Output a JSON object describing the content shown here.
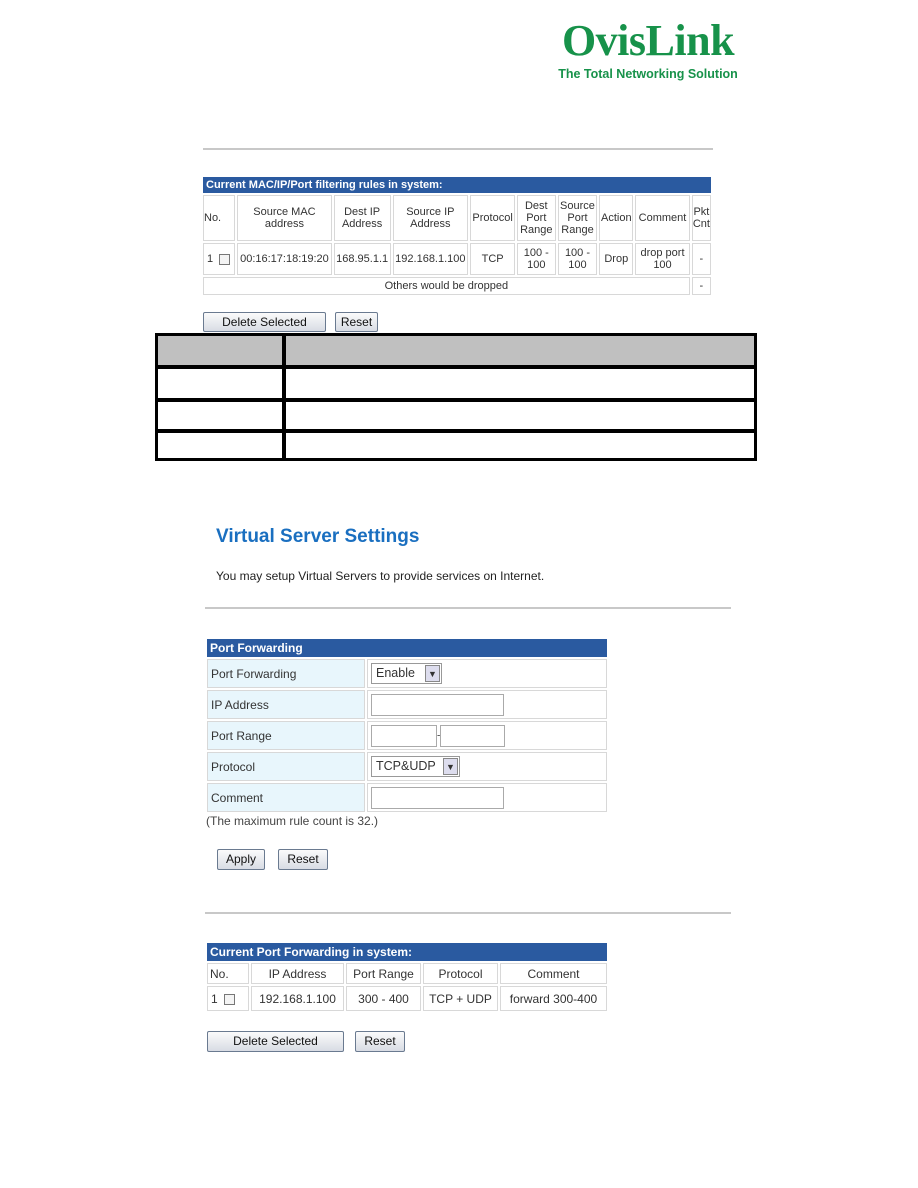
{
  "logo": {
    "name": "OvisLink",
    "tagline": "The Total Networking Solution",
    "color": "#17924a"
  },
  "filter_table": {
    "title": "Current MAC/IP/Port filtering rules in system:",
    "headers": [
      "No.",
      "Source MAC address",
      "Dest IP Address",
      "Source IP Address",
      "Protocol",
      "Dest Port Range",
      "Source Port Range",
      "Action",
      "Comment",
      "Pkt Cnt"
    ],
    "rows": [
      [
        "1",
        "00:16:17:18:19:20",
        "168.95.1.1",
        "192.168.1.100",
        "TCP",
        "100 - 100",
        "100 - 100",
        "Drop",
        "drop port 100",
        "-"
      ]
    ],
    "footer": "Others would be dropped",
    "footer_cnt": "-",
    "delete_label": "Delete Selected",
    "reset_label": "Reset"
  },
  "virtual_server": {
    "title": "Virtual Server Settings",
    "description": "You may setup Virtual Servers to provide services on Internet.",
    "form": {
      "title": "Port Forwarding",
      "port_forwarding_label": "Port Forwarding",
      "port_forwarding_value": "Enable",
      "ip_label": "IP Address",
      "ip_value": "",
      "port_range_label": "Port Range",
      "port_from": "",
      "port_to": "",
      "range_sep": "-",
      "protocol_label": "Protocol",
      "protocol_value": "TCP&UDP",
      "comment_label": "Comment",
      "comment_value": ""
    },
    "note": "(The maximum rule count is 32.)",
    "apply_label": "Apply",
    "reset_label": "Reset"
  },
  "current_pf": {
    "title": "Current Port Forwarding in system:",
    "headers": [
      "No.",
      "IP Address",
      "Port Range",
      "Protocol",
      "Comment"
    ],
    "rows": [
      [
        "1",
        "192.168.1.100",
        "300 - 400",
        "TCP + UDP",
        "forward 300-400"
      ]
    ],
    "delete_label": "Delete Selected",
    "reset_label": "Reset"
  }
}
